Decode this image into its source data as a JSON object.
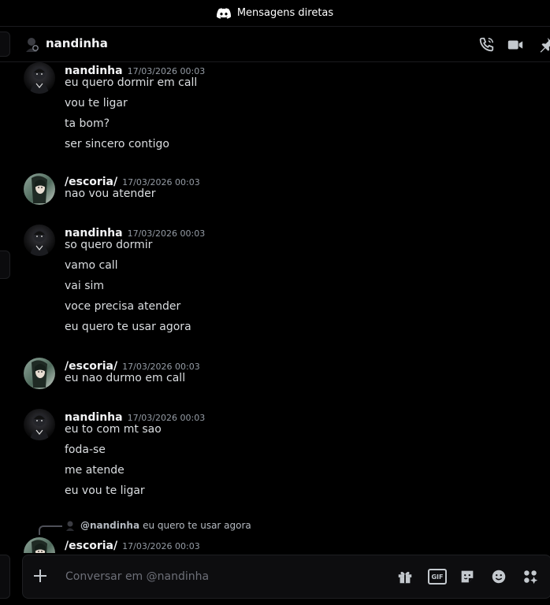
{
  "top_bar": {
    "title": "Mensagens diretas",
    "logo_icon": "discord-logo-icon"
  },
  "dm_header": {
    "user_name": "nandinha",
    "icons": [
      "voice-call-icon",
      "video-call-icon",
      "pin-icon"
    ]
  },
  "messages": [
    {
      "author": "nandinha",
      "timestamp": "17/03/2026 00:03",
      "avatar": "nandinha-avatar",
      "lines": [
        "eu quero dormir em call",
        "vou te ligar",
        "ta bom?",
        "ser sincero contigo"
      ]
    },
    {
      "author": "/escoria/",
      "timestamp": "17/03/2026 00:03",
      "avatar": "escoria-avatar",
      "lines": [
        "nao vou atender"
      ]
    },
    {
      "author": "nandinha",
      "timestamp": "17/03/2026 00:03",
      "avatar": "nandinha-avatar",
      "lines": [
        "so quero dormir",
        "vamo call",
        "vai sim",
        "voce precisa atender",
        "eu quero te usar agora"
      ]
    },
    {
      "author": "/escoria/",
      "timestamp": "17/03/2026 00:03",
      "avatar": "escoria-avatar",
      "lines": [
        "eu nao durmo em call"
      ]
    },
    {
      "author": "nandinha",
      "timestamp": "17/03/2026 00:03",
      "avatar": "nandinha-avatar",
      "lines": [
        "eu to com mt sao",
        "foda-se",
        "me atende",
        "eu vou te ligar"
      ]
    },
    {
      "author": "/escoria/",
      "timestamp": "17/03/2026 00:03",
      "avatar": "escoria-avatar",
      "reply_to": {
        "mention": "@nandinha",
        "text": "eu quero te usar agora"
      },
      "lines": []
    }
  ],
  "composer": {
    "placeholder": "Conversar em @nandinha",
    "icons": [
      "add-attachment-icon",
      "gift-icon",
      "gif-icon",
      "sticker-icon",
      "emoji-icon",
      "apps-icon"
    ],
    "gif_label": "GIF"
  },
  "colors": {
    "background": "#000000",
    "text": "#dbdee1",
    "muted": "#949ba4",
    "author": "#f2f3f5"
  }
}
